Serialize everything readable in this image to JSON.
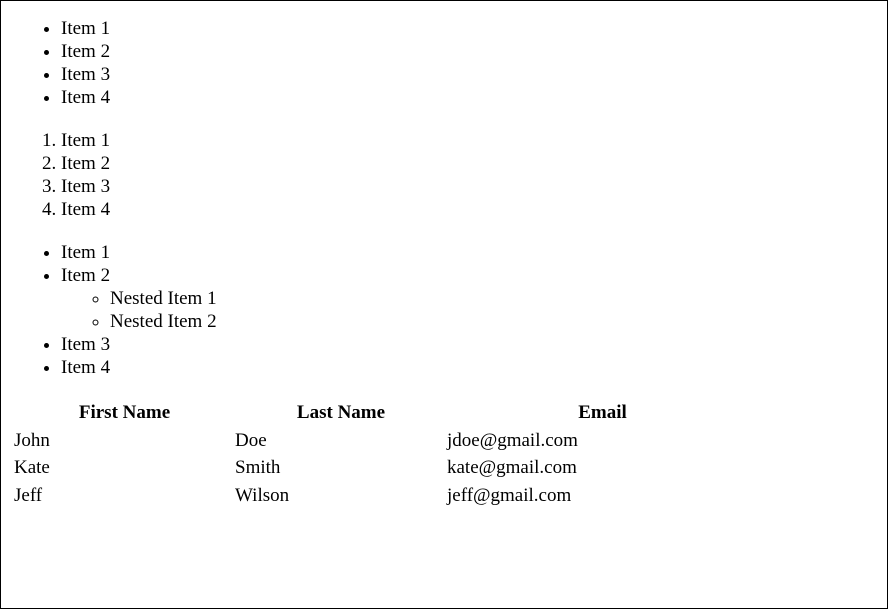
{
  "list_unordered": {
    "items": [
      "Item 1",
      "Item 2",
      "Item 3",
      "Item 4"
    ]
  },
  "list_ordered": {
    "items": [
      "Item 1",
      "Item 2",
      "Item 3",
      "Item 4"
    ]
  },
  "list_nested": {
    "items": [
      "Item 1",
      "Item 2",
      "Item 3",
      "Item 4"
    ],
    "nested_items": [
      "Nested Item 1",
      "Nested Item 2"
    ]
  },
  "table": {
    "headers": [
      "First Name",
      "Last Name",
      "Email"
    ],
    "rows": [
      [
        "John",
        "Doe",
        "jdoe@gmail.com"
      ],
      [
        "Kate",
        "Smith",
        "kate@gmail.com"
      ],
      [
        "Jeff",
        "Wilson",
        "jeff@gmail.com"
      ]
    ]
  }
}
